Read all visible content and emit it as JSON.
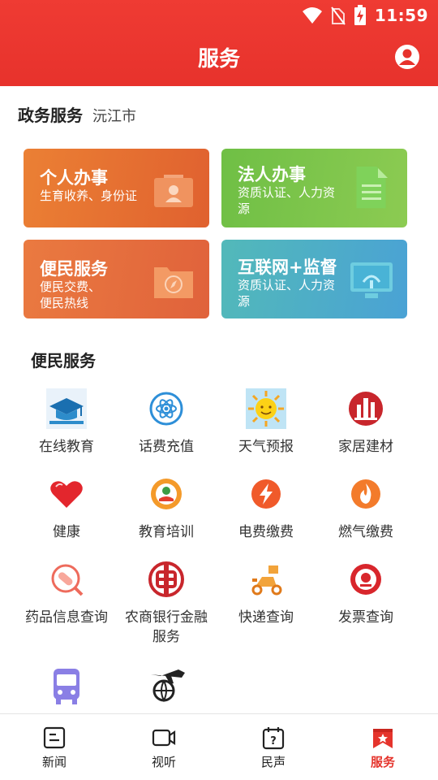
{
  "status": {
    "time": "11:59"
  },
  "header": {
    "title": "服务"
  },
  "gov": {
    "title": "政务服务",
    "city": "沅江市"
  },
  "cards": [
    {
      "title": "个人办事",
      "subtitle": "生育收养、身份证"
    },
    {
      "title": "法人办事",
      "subtitle": "资质认证、人力资源"
    },
    {
      "title": "便民服务",
      "subtitle": "便民交费、便民热线"
    },
    {
      "title": "互联网+监督",
      "subtitle": "资质认证、人力资源"
    }
  ],
  "convenience": {
    "title": "便民服务",
    "items": [
      {
        "label": "在线教育"
      },
      {
        "label": "话费充值"
      },
      {
        "label": "天气预报"
      },
      {
        "label": "家居建材"
      },
      {
        "label": "健康"
      },
      {
        "label": "教育培训"
      },
      {
        "label": "电费缴费"
      },
      {
        "label": "燃气缴费"
      },
      {
        "label": "药品信息查询"
      },
      {
        "label": "农商银行金融服务"
      },
      {
        "label": "快递查询"
      },
      {
        "label": "发票查询"
      },
      {
        "label": ""
      },
      {
        "label": ""
      }
    ]
  },
  "nav": [
    {
      "label": "新闻"
    },
    {
      "label": "视听"
    },
    {
      "label": "民声"
    },
    {
      "label": "服务"
    }
  ],
  "colors": {
    "brand": "#e5342c",
    "active": "#e5342c"
  }
}
